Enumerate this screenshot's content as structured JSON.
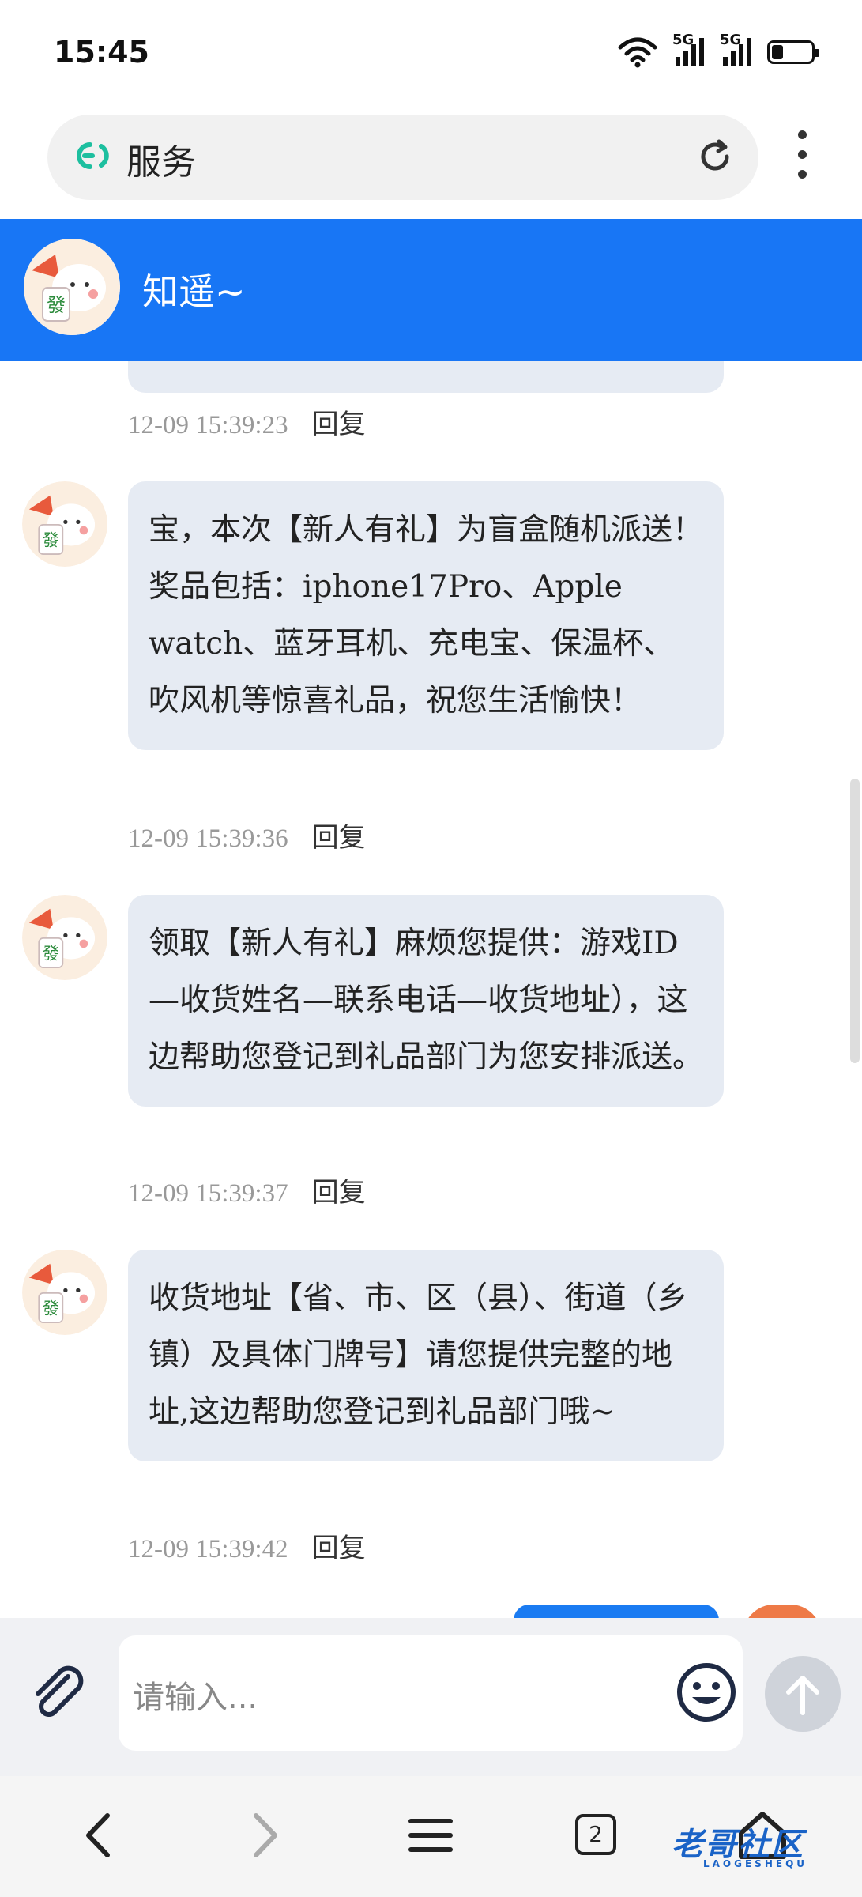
{
  "status_bar": {
    "time": "15:45",
    "network_1": "5G",
    "network_2": "5G"
  },
  "address_bar": {
    "title": "服务"
  },
  "chat_header": {
    "name": "知遥~"
  },
  "messages": [
    {
      "text": "",
      "timestamp": "12-09 15:39:23",
      "reply_label": "回复"
    },
    {
      "text": "宝，本次【新人有礼】为盲盒随机派送！奖品包括：iphone17Pro、Apple watch、蓝牙耳机、充电宝、保温杯、吹风机等惊喜礼品，祝您生活愉快！",
      "timestamp": "12-09 15:39:36",
      "reply_label": "回复"
    },
    {
      "text": "领取【新人有礼】麻烦您提供：游戏ID—收货姓名—联系电话—收货地址），这边帮助您登记到礼品部门为您安排派送。",
      "timestamp": "12-09 15:39:37",
      "reply_label": "回复"
    },
    {
      "text": "收货地址【省、市、区（县）、街道（乡镇）及具体门牌号】请您提供完整的地址,这边帮助您登记到礼品部门哦~",
      "timestamp": "12-09 15:39:42",
      "reply_label": "回复"
    }
  ],
  "input": {
    "placeholder": "请输入..."
  },
  "bottom_nav": {
    "tabs_count": "2"
  },
  "watermark": {
    "text": "老哥社区",
    "subtext": "LAOGESHEQU"
  },
  "colors": {
    "header_blue": "#1876f5",
    "bubble": "#e6ebf3",
    "accent_teal": "#1dbf9f"
  }
}
